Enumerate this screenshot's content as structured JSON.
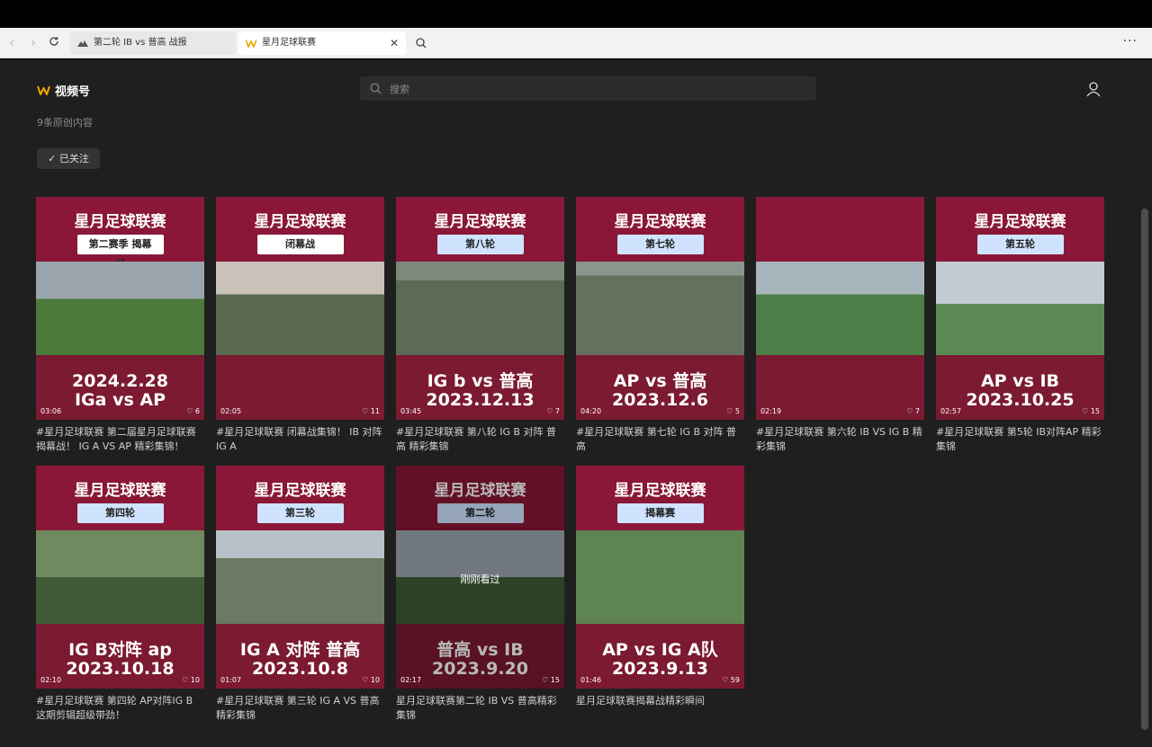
{
  "browser": {
    "tabs": [
      {
        "label": "第二轮 IB vs 普高 战报"
      },
      {
        "label": "星月足球联赛"
      }
    ]
  },
  "header": {
    "app_name": "视频号",
    "search_placeholder": "搜索"
  },
  "profile": {
    "count_text": "9条原创内容",
    "follow_label": "已关注"
  },
  "videos": [
    {
      "title": "星月足球联赛",
      "tag": "第二赛季\n揭幕战",
      "big": "2024.2.28\nIGa vs AP",
      "dur": "03:06",
      "likes": "6",
      "desc": "#星月足球联赛 第二届星月足球联赛揭幕战！ IG A VS AP 精彩集锦！"
    },
    {
      "title": "星月足球联赛",
      "tag": "闭幕战",
      "big": "",
      "dur": "02:05",
      "likes": "11",
      "desc": "#星月足球联赛 闭幕战集锦！ IB 对阵 IG A"
    },
    {
      "title": "星月足球联赛",
      "tag": "第八轮",
      "big": "IG b vs 普高\n2023.12.13",
      "dur": "03:45",
      "likes": "7",
      "desc": "#星月足球联赛 第八轮 IG B 对阵 普高 精彩集锦"
    },
    {
      "title": "星月足球联赛",
      "tag": "第七轮",
      "big": "AP vs 普高\n2023.12.6",
      "dur": "04:20",
      "likes": "5",
      "desc": "#星月足球联赛 第七轮 IG B 对阵 普高"
    },
    {
      "title": "",
      "tag": "",
      "big": "",
      "dur": "02:19",
      "likes": "7",
      "desc": "#星月足球联赛 第六轮 IB VS IG B 精彩集锦"
    },
    {
      "title": "星月足球联赛",
      "tag": "第五轮",
      "big": "AP vs IB\n2023.10.25",
      "dur": "02:57",
      "likes": "15",
      "desc": "#星月足球联赛 第5轮 IB对阵AP 精彩集锦"
    },
    {
      "title": "星月足球联赛",
      "tag": "第四轮",
      "big": "IG B对阵 ap\n2023.10.18",
      "dur": "02:10",
      "likes": "10",
      "desc": "#星月足球联赛 第四轮 AP对阵IG B 这期剪辑超级带劲！"
    },
    {
      "title": "星月足球联赛",
      "tag": "第三轮",
      "big": "IG A 对阵 普高\n2023.10.8",
      "dur": "01:07",
      "likes": "10",
      "desc": "#星月足球联赛 第三轮 IG A VS 普高 精彩集锦"
    },
    {
      "title": "星月足球联赛",
      "tag": "第二轮",
      "big": "普高 vs IB\n2023.9.20",
      "dur": "02:17",
      "likes": "15",
      "desc": "星月足球联赛第二轮 IB VS 普高精彩集锦",
      "watched": "刚刚看过"
    },
    {
      "title": "星月足球联赛",
      "tag": "揭幕赛",
      "big": "AP vs IG A队\n2023.9.13",
      "dur": "01:46",
      "likes": "59",
      "desc": "星月足球联赛揭幕战精彩瞬间"
    }
  ]
}
